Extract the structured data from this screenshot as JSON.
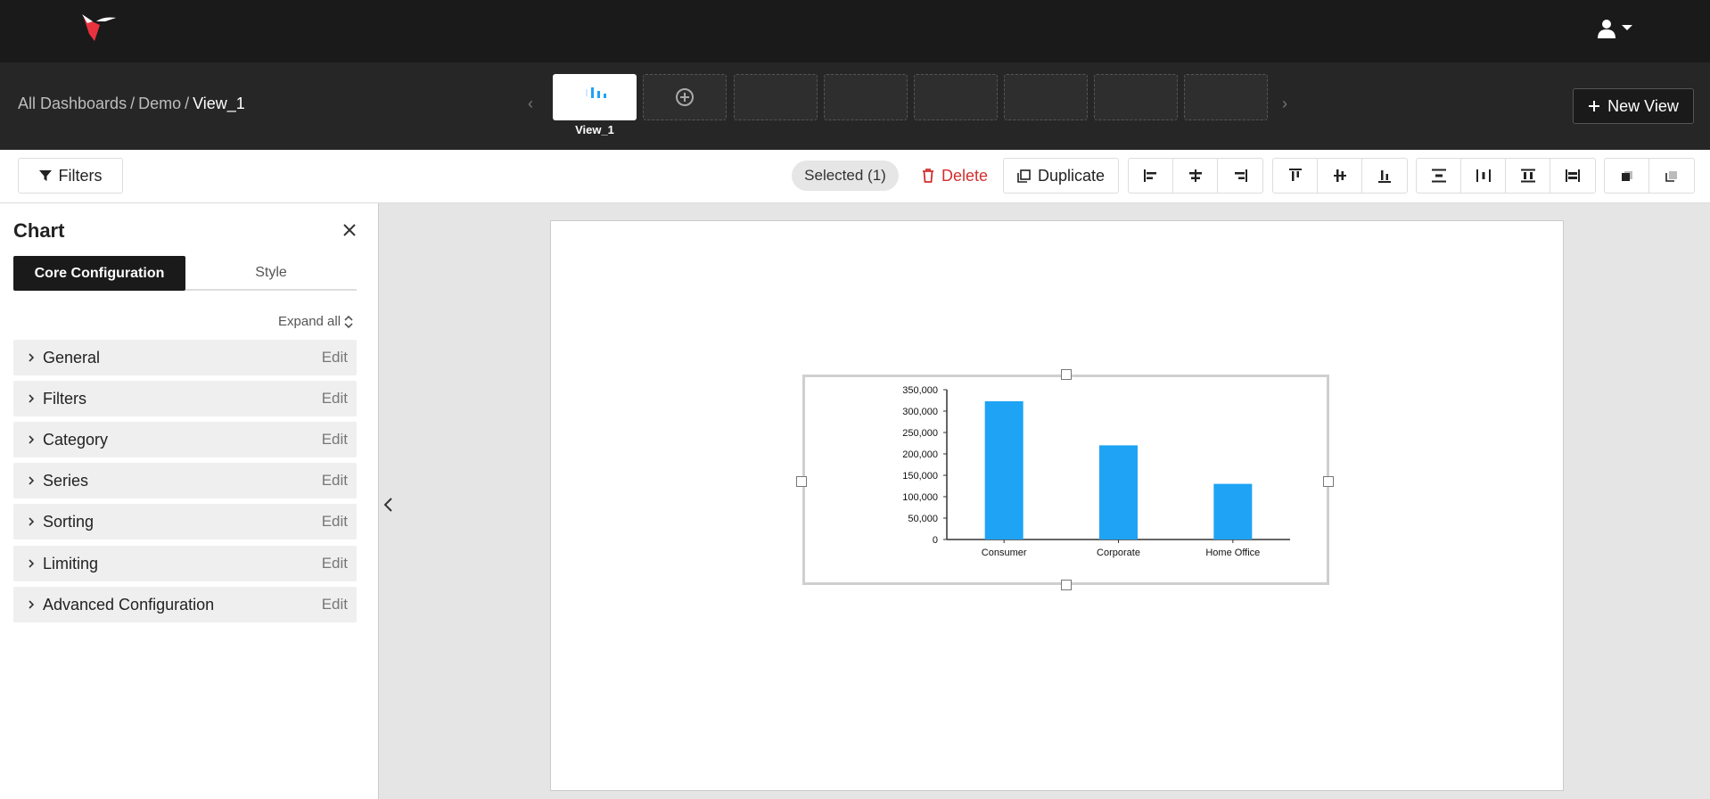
{
  "header": {
    "logo_icon": "hummingbird-logo-icon",
    "user_icon": "user-icon"
  },
  "viewbar": {
    "breadcrumb": {
      "root": "All Dashboards",
      "dashboard": "Demo",
      "current": "View_1",
      "separator": "/"
    },
    "views": [
      {
        "label": "View_1",
        "active": true
      }
    ],
    "new_view_label": "New View"
  },
  "toolbar": {
    "filters_label": "Filters",
    "selected_label": "Selected (1)",
    "delete_label": "Delete",
    "duplicate_label": "Duplicate"
  },
  "panel": {
    "title": "Chart",
    "tabs": [
      "Core Configuration",
      "Style"
    ],
    "expand_all": "Expand all",
    "sections": [
      {
        "name": "General",
        "action": "Edit"
      },
      {
        "name": "Filters",
        "action": "Edit"
      },
      {
        "name": "Category",
        "action": "Edit"
      },
      {
        "name": "Series",
        "action": "Edit"
      },
      {
        "name": "Sorting",
        "action": "Edit"
      },
      {
        "name": "Limiting",
        "action": "Edit"
      },
      {
        "name": "Advanced Configuration",
        "action": "Edit"
      }
    ]
  },
  "colors": {
    "bar": "#1fa3f5",
    "delete": "#d32f2f",
    "logo_accent": "#e8333f"
  },
  "chart_data": {
    "type": "bar",
    "categories": [
      "Consumer",
      "Corporate",
      "Home Office"
    ],
    "values": [
      323000,
      220000,
      130000
    ],
    "ylim": [
      0,
      350000
    ],
    "yticks": [
      "0",
      "50,000",
      "100,000",
      "150,000",
      "200,000",
      "250,000",
      "300,000",
      "350,000"
    ],
    "title": "",
    "xlabel": "",
    "ylabel": "",
    "grid": false,
    "legend": "none"
  }
}
